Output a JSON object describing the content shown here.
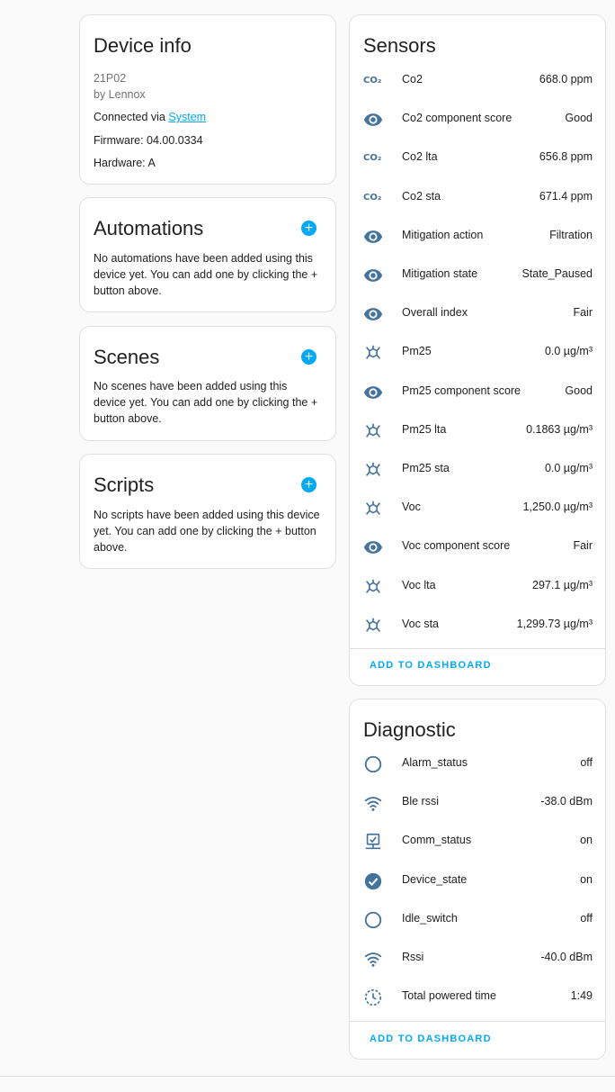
{
  "device_info": {
    "title": "Device info",
    "model": "21P02",
    "manufacturer": "by Lennox",
    "connected_prefix": "Connected via ",
    "connected_link": "System",
    "firmware": "Firmware: 04.00.0334",
    "hardware": "Hardware: A"
  },
  "automations": {
    "title": "Automations",
    "add_label": "+",
    "description": "No automations have been added using this device yet. You can add one by clicking the + button above."
  },
  "scenes": {
    "title": "Scenes",
    "add_label": "+",
    "description": "No scenes have been added using this device yet. You can add one by clicking the + button above."
  },
  "scripts": {
    "title": "Scripts",
    "add_label": "+",
    "description": "No scripts have been added using this device yet. You can add one by clicking the + button above."
  },
  "sensors": {
    "title": "Sensors",
    "add_to_dashboard": "ADD TO DASHBOARD",
    "rows": [
      {
        "icon": "co2-icon",
        "name": "Co2",
        "value": "668.0 ppm"
      },
      {
        "icon": "eye-icon",
        "name": "Co2 component score",
        "value": "Good"
      },
      {
        "icon": "co2-icon",
        "name": "Co2 lta",
        "value": "656.8 ppm"
      },
      {
        "icon": "co2-icon",
        "name": "Co2 sta",
        "value": "671.4 ppm"
      },
      {
        "icon": "eye-icon",
        "name": "Mitigation action",
        "value": "Filtration"
      },
      {
        "icon": "eye-icon",
        "name": "Mitigation state",
        "value": "State_Paused"
      },
      {
        "icon": "eye-icon",
        "name": "Overall index",
        "value": "Fair"
      },
      {
        "icon": "molecule-icon",
        "name": "Pm25",
        "value": "0.0 µg/m³"
      },
      {
        "icon": "eye-icon",
        "name": "Pm25 component score",
        "value": "Good"
      },
      {
        "icon": "molecule-icon",
        "name": "Pm25 lta",
        "value": "0.1863 µg/m³"
      },
      {
        "icon": "molecule-icon",
        "name": "Pm25 sta",
        "value": "0.0 µg/m³"
      },
      {
        "icon": "molecule-icon",
        "name": "Voc",
        "value": "1,250.0 µg/m³"
      },
      {
        "icon": "eye-icon",
        "name": "Voc component score",
        "value": "Fair"
      },
      {
        "icon": "molecule-icon",
        "name": "Voc lta",
        "value": "297.1 µg/m³"
      },
      {
        "icon": "molecule-icon",
        "name": "Voc sta",
        "value": "1,299.73 µg/m³"
      }
    ]
  },
  "diagnostic": {
    "title": "Diagnostic",
    "add_to_dashboard": "ADD TO DASHBOARD",
    "rows": [
      {
        "icon": "circle-outline-icon",
        "name": "Alarm_status",
        "value": "off"
      },
      {
        "icon": "wifi-icon",
        "name": "Ble rssi",
        "value": "-38.0 dBm"
      },
      {
        "icon": "monitor-check-icon",
        "name": "Comm_status",
        "value": "on"
      },
      {
        "icon": "check-circle-icon",
        "name": "Device_state",
        "value": "on"
      },
      {
        "icon": "circle-outline-icon",
        "name": "Idle_switch",
        "value": "off"
      },
      {
        "icon": "wifi-icon",
        "name": "Rssi",
        "value": "-40.0 dBm"
      },
      {
        "icon": "clock-icon",
        "name": "Total powered time",
        "value": "1:49"
      }
    ]
  },
  "colors": {
    "accent": "#03a9f4",
    "icon": "#44739e",
    "text": "#212121",
    "muted": "#727272"
  }
}
